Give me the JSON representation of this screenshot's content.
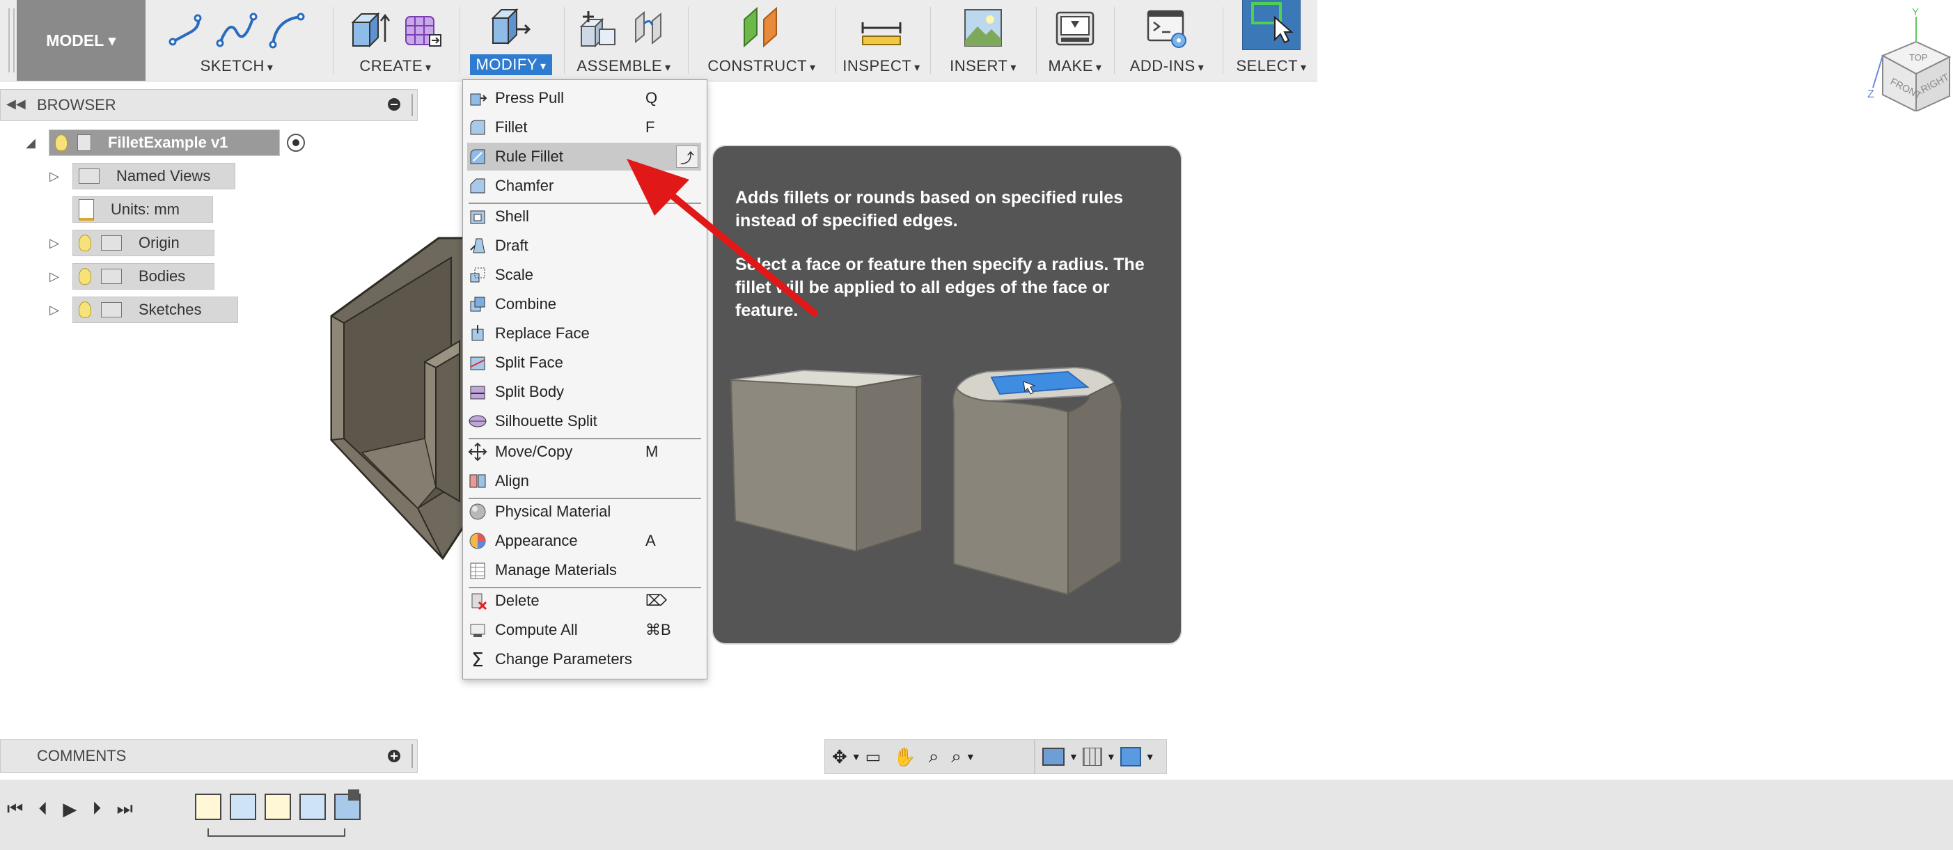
{
  "toolbar": {
    "model_label": "MODEL ▾",
    "groups": {
      "sketch": "SKETCH",
      "create": "CREATE",
      "modify": "MODIFY",
      "assemble": "ASSEMBLE",
      "construct": "CONSTRUCT",
      "inspect": "INSPECT",
      "insert": "INSERT",
      "make": "MAKE",
      "addins": "ADD-INS",
      "select": "SELECT"
    },
    "caret": "▾",
    "accent": "#2e7bcf"
  },
  "browser": {
    "title": "BROWSER",
    "root": "FilletExample v1",
    "items": [
      "Named Views",
      "Units: mm",
      "Origin",
      "Bodies",
      "Sketches"
    ]
  },
  "menu": {
    "items": [
      {
        "label": "Press Pull",
        "shortcut": "Q"
      },
      {
        "label": "Fillet",
        "shortcut": "F"
      },
      {
        "label": "Rule Fillet",
        "shortcut": ""
      },
      {
        "label": "Chamfer",
        "shortcut": ""
      },
      {
        "label": "Shell",
        "shortcut": ""
      },
      {
        "label": "Draft",
        "shortcut": ""
      },
      {
        "label": "Scale",
        "shortcut": ""
      },
      {
        "label": "Combine",
        "shortcut": ""
      },
      {
        "label": "Replace Face",
        "shortcut": ""
      },
      {
        "label": "Split Face",
        "shortcut": ""
      },
      {
        "label": "Split Body",
        "shortcut": ""
      },
      {
        "label": "Silhouette Split",
        "shortcut": ""
      },
      {
        "label": "Move/Copy",
        "shortcut": "M"
      },
      {
        "label": "Align",
        "shortcut": ""
      },
      {
        "label": "Physical Material",
        "shortcut": ""
      },
      {
        "label": "Appearance",
        "shortcut": "A"
      },
      {
        "label": "Manage Materials",
        "shortcut": ""
      },
      {
        "label": "Delete",
        "shortcut": "⌦"
      },
      {
        "label": "Compute All",
        "shortcut": "⌘B"
      },
      {
        "label": "Change Parameters",
        "shortcut": ""
      }
    ]
  },
  "tooltip": {
    "line1": "Adds fillets or rounds based on specified rules instead of specified edges.",
    "line2": "Select a face or feature then specify a radius. The fillet will be applied to all edges of the face or feature."
  },
  "comments": {
    "title": "COMMENTS"
  },
  "viewcube": {
    "top": "TOP",
    "front": "FRONT",
    "right": "RIGHT",
    "axis_y": "Y",
    "axis_z": "Z"
  },
  "icons": {
    "pin": "pin-icon",
    "add": "plus-icon",
    "collapse": "double-left-icon"
  }
}
